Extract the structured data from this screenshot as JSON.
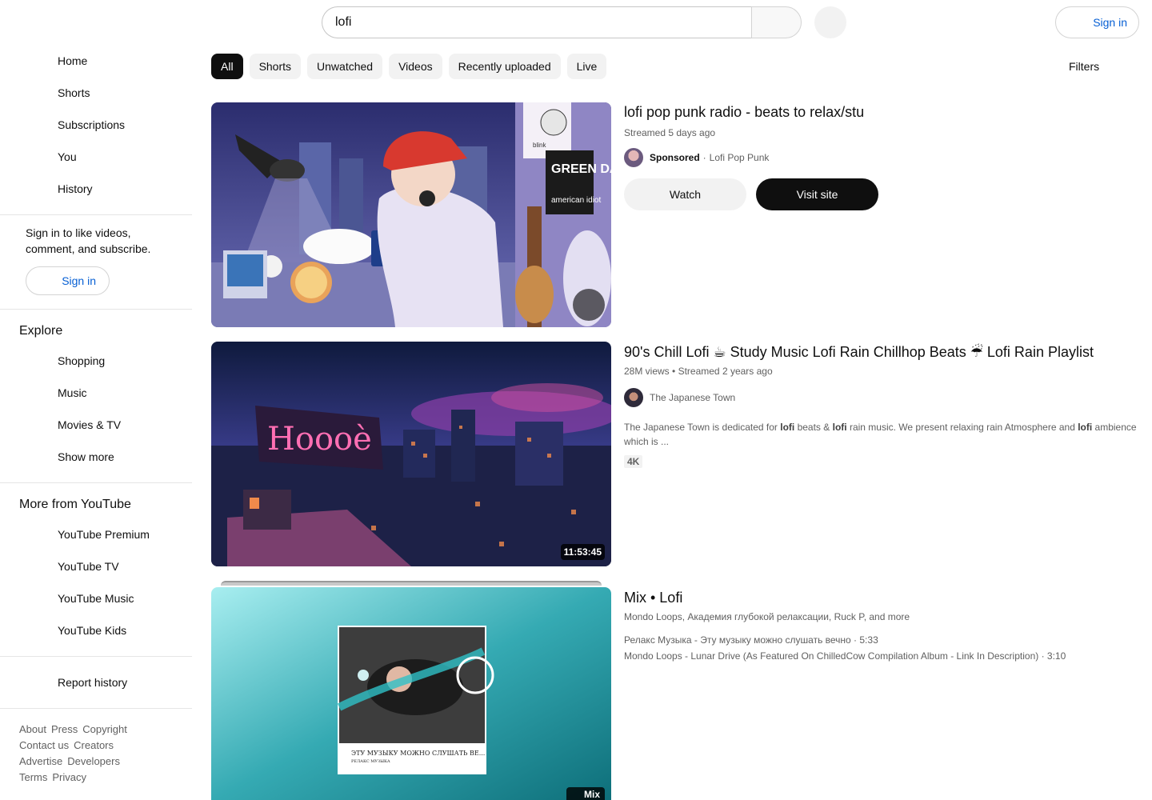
{
  "header": {
    "search_value": "lofi",
    "sign_in_label": "Sign in"
  },
  "sidebar": {
    "main": [
      {
        "label": "Home",
        "icon": "home-icon"
      },
      {
        "label": "Shorts",
        "icon": "shorts-icon"
      },
      {
        "label": "Subscriptions",
        "icon": "subscriptions-icon"
      },
      {
        "label": "You",
        "icon": "you-icon"
      },
      {
        "label": "History",
        "icon": "history-icon"
      }
    ],
    "signin_prompt": "Sign in to like videos, comment, and subscribe.",
    "signin_label": "Sign in",
    "explore_title": "Explore",
    "explore": [
      {
        "label": "Shopping"
      },
      {
        "label": "Music"
      },
      {
        "label": "Movies & TV"
      },
      {
        "label": "Show more"
      }
    ],
    "more_title": "More from YouTube",
    "more": [
      {
        "label": "YouTube Premium"
      },
      {
        "label": "YouTube TV"
      },
      {
        "label": "YouTube Music"
      },
      {
        "label": "YouTube Kids"
      }
    ],
    "report_history": "Report history",
    "footer": [
      [
        "About",
        "Press",
        "Copyright"
      ],
      [
        "Contact us",
        "Creators"
      ],
      [
        "Advertise",
        "Developers"
      ],
      [
        "Terms",
        "Privacy"
      ]
    ]
  },
  "chips": [
    "All",
    "Shorts",
    "Unwatched",
    "Videos",
    "Recently uploaded",
    "Live"
  ],
  "filters_label": "Filters",
  "results": [
    {
      "title": "lofi pop punk radio - beats to relax/stu",
      "meta": "Streamed 5 days ago",
      "sponsored": "Sponsored",
      "channel": "Lofi Pop Punk",
      "watch_label": "Watch",
      "visit_label": "Visit site"
    },
    {
      "title": "90's Chill Lofi ☕ Study Music Lofi Rain Chillhop Beats ☔ Lofi Rain Playlist",
      "meta_views": "28M views",
      "meta_time": "Streamed 2 years ago",
      "channel": "The Japanese Town",
      "desc_1": "The Japanese Town is dedicated for ",
      "desc_kw1": "lofi",
      "desc_2": " beats & ",
      "desc_kw2": "lofi",
      "desc_3": " rain music. We present relaxing rain Atmosphere and ",
      "desc_kw3": "lofi",
      "desc_4": " ambience which is ...",
      "badge": "4K",
      "duration": "11:53:45"
    },
    {
      "title": "Mix • Lofi",
      "subtitle": "Mondo Loops, Академия глубокой релаксации, Ruck P, and more",
      "line1": "Релакс Музыка - Эту музыку можно слушать вечно · 5:33",
      "line2": "Mondo Loops - Lunar Drive (As Featured On ChilledCow Compilation Album - Link In Description) · 3:10",
      "badge": "Mix",
      "card_text_1": "ЭТУ МУЗЫКУ МОЖНО СЛУШАТЬ ВЕ...",
      "card_text_2": "РЕЛАКС МУЗЫКА"
    }
  ],
  "thumb1_text": {
    "sign": "GREEN DAY",
    "sign2": "american idiot",
    "band": "blink"
  }
}
